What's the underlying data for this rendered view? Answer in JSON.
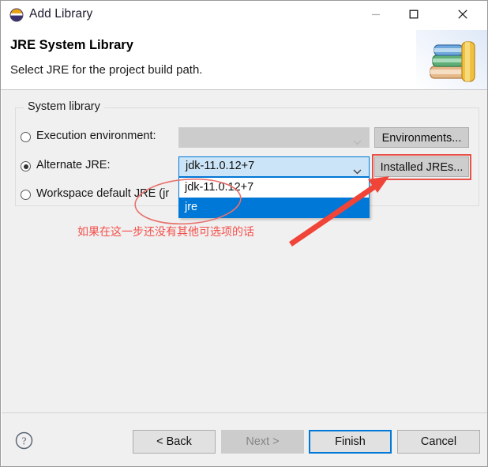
{
  "window": {
    "title": "Add Library",
    "icon": "eclipse-icon",
    "controls": {
      "minimize": "minimize-icon",
      "maximize": "maximize-icon",
      "close": "close-icon"
    }
  },
  "header": {
    "title": "JRE System Library",
    "description": "Select JRE for the project build path.",
    "image": "books-stack-icon"
  },
  "group": {
    "label": "System library",
    "options": [
      {
        "label": "Execution environment:",
        "selected": false,
        "combo": {
          "value": "",
          "disabled": true
        },
        "button": "Environments..."
      },
      {
        "label": "Alternate JRE:",
        "selected": true,
        "combo": {
          "value": "jdk-11.0.12+7",
          "disabled": false
        },
        "button": "Installed JREs..."
      },
      {
        "label": "Workspace default JRE (jr",
        "selected": false
      }
    ]
  },
  "dropdown": {
    "open": true,
    "items": [
      {
        "label": "jdk-11.0.12+7",
        "selected": false
      },
      {
        "label": "jre",
        "selected": true
      }
    ]
  },
  "annotations": {
    "note_text": "如果在这一步还没有其他可选项的话",
    "color": "#f4504b",
    "ellipse": "red-ellipse-highlight",
    "arrow": "red-arrow-pointer",
    "rect": "red-rectangle-highlight"
  },
  "footer": {
    "help": "help-icon",
    "buttons": [
      {
        "label": "< Back",
        "enabled": true,
        "default": false
      },
      {
        "label": "Next >",
        "enabled": false,
        "default": false
      },
      {
        "label": "Finish",
        "enabled": true,
        "default": true
      },
      {
        "label": "Cancel",
        "enabled": true,
        "default": false
      }
    ]
  },
  "colors": {
    "accent": "#0078d7",
    "annotation": "#f4504b",
    "body": "#f0f0f0"
  }
}
